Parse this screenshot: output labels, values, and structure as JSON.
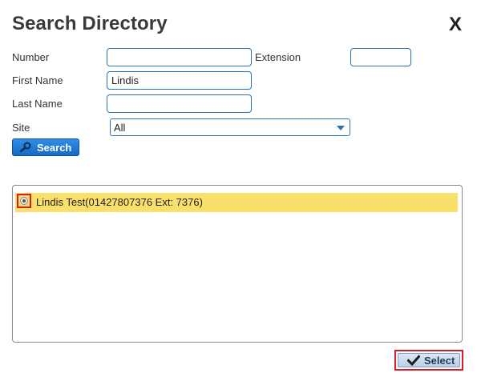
{
  "dialog": {
    "title": "Search Directory",
    "close_label": "X"
  },
  "form": {
    "number_label": "Number",
    "number_value": "",
    "extension_label": "Extension",
    "extension_value": "",
    "first_name_label": "First Name",
    "first_name_value": "Lindis",
    "last_name_label": "Last Name",
    "last_name_value": "",
    "site_label": "Site",
    "site_value": "All",
    "search_label": "Search",
    "search_icon": "search-icon"
  },
  "results": [
    {
      "label": "Lindis Test(01427807376 Ext: 7376)",
      "selected": true
    }
  ],
  "footer": {
    "select_label": "Select",
    "select_icon": "checkmark-icon"
  },
  "colors": {
    "accent": "#1f7fd6",
    "highlight_row": "#f9e06a",
    "annotation_red": "#d81d27"
  }
}
